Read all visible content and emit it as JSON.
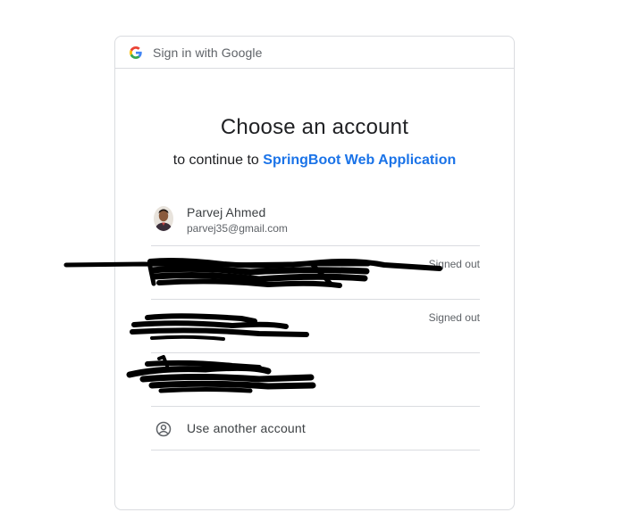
{
  "header": {
    "title": "Sign in with Google",
    "logo_icon": "google-g-icon"
  },
  "heading": {
    "title": "Choose an account",
    "subtitle_prefix": "to continue to ",
    "app_name": "SpringBoot Web Application"
  },
  "accounts": [
    {
      "name": "Parvej Ahmed",
      "email": "parvej35@gmail.com",
      "status": "",
      "redacted": false
    },
    {
      "name": "",
      "email": "",
      "status": "Signed out",
      "redacted": true
    },
    {
      "name": "",
      "email": "",
      "status": "Signed out",
      "redacted": true
    },
    {
      "name": "",
      "email": "",
      "status": "",
      "redacted": true
    }
  ],
  "use_another": {
    "label": "Use another account",
    "icon": "account-circle-icon"
  },
  "colors": {
    "accent": "#1a73e8",
    "border": "#dadce0",
    "text": "#202124",
    "secondary_text": "#5f6368",
    "redaction": "#000000"
  }
}
